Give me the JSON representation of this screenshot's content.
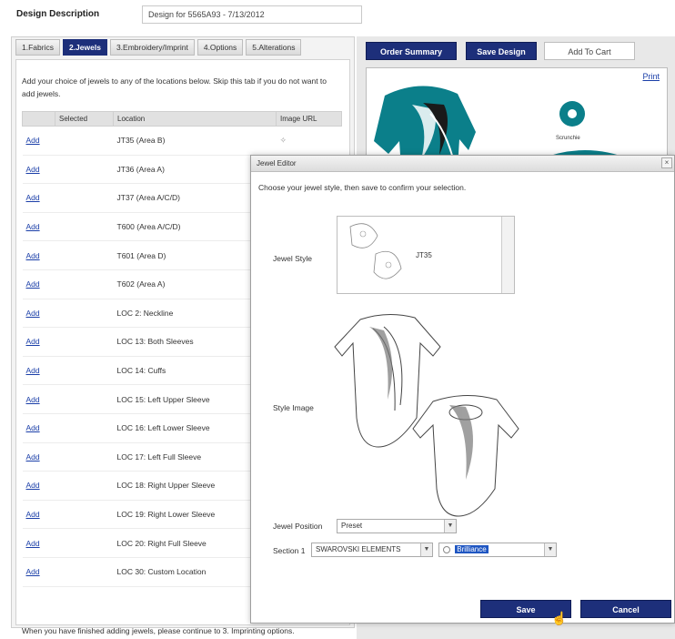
{
  "header": {
    "label": "Design Description",
    "value": "Design for 5565A93 - 7/13/2012"
  },
  "tabs": [
    {
      "label": "1.Fabrics"
    },
    {
      "label": "2.Jewels"
    },
    {
      "label": "3.Embroidery/Imprint"
    },
    {
      "label": "4.Options"
    },
    {
      "label": "5.Alterations"
    }
  ],
  "jewels_tab": {
    "intro": "Add your choice of jewels to any of the locations below. Skip this tab if you do not want to add jewels.",
    "columns": [
      "",
      "Selected",
      "Location",
      "Image URL"
    ],
    "add_label": "Add",
    "rows": [
      {
        "location": "JT35 (Area B)"
      },
      {
        "location": "JT36 (Area A)"
      },
      {
        "location": "JT37 (Area A/C/D)"
      },
      {
        "location": "T600 (Area A/C/D)"
      },
      {
        "location": "T601 (Area D)"
      },
      {
        "location": "T602 (Area A)"
      },
      {
        "location": "LOC 2: Neckline"
      },
      {
        "location": "LOC 13: Both Sleeves"
      },
      {
        "location": "LOC 14: Cuffs"
      },
      {
        "location": "LOC 15: Left Upper Sleeve"
      },
      {
        "location": "LOC 16: Left Lower Sleeve"
      },
      {
        "location": "LOC 17: Left Full Sleeve"
      },
      {
        "location": "LOC 18: Right Upper Sleeve"
      },
      {
        "location": "LOC 19: Right Lower Sleeve"
      },
      {
        "location": "LOC 20: Right Full Sleeve"
      },
      {
        "location": "LOC 30: Custom Location"
      }
    ],
    "footer": "When you have finished adding jewels, please continue to 3. Imprinting options."
  },
  "right": {
    "order_summary": "Order Summary",
    "save_design": "Save Design",
    "add_to_cart": "Add To Cart",
    "print": "Print",
    "scrunchie_label": "Scrunchie"
  },
  "modal": {
    "title": "Jewel Editor",
    "instructions": "Choose your jewel style, then save to confirm your selection.",
    "jewel_style_label": "Jewel Style",
    "jewel_style_code": "JT35",
    "style_image_label": "Style Image",
    "jewel_position_label": "Jewel Position",
    "jewel_position_value": "Preset",
    "section_label": "Section 1",
    "section_value": "SWAROVSKI ELEMENTS",
    "stone_value": "Brilliance",
    "save": "Save",
    "cancel": "Cancel"
  },
  "colors": {
    "accent": "#1d2f7a",
    "teal": "#0b7f8a",
    "link": "#1a3ea8"
  }
}
